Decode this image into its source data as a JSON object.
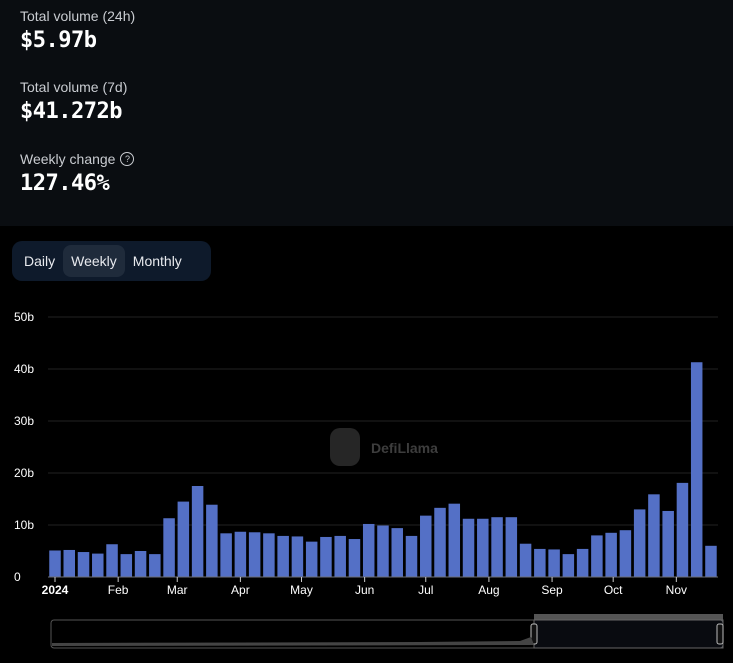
{
  "stats": [
    {
      "label": "Total volume (24h)",
      "value": "$5.97b"
    },
    {
      "label": "Total volume (7d)",
      "value": "$41.272b"
    },
    {
      "label": "Weekly change",
      "value": "127.46%",
      "icon": "help-circle-icon"
    }
  ],
  "toggle": {
    "options": [
      "Daily",
      "Weekly",
      "Monthly"
    ],
    "selected": "Weekly"
  },
  "watermark": "DefiLlama",
  "chart_data": {
    "type": "bar",
    "title": "",
    "xlabel": "",
    "ylabel": "",
    "bar_color": "#5470c6",
    "ylim": [
      0,
      50
    ],
    "yticks": [
      "0",
      "10b",
      "20b",
      "30b",
      "40b",
      "50b"
    ],
    "xtick_labels": [
      "2024",
      "Feb",
      "Mar",
      "Apr",
      "May",
      "Jun",
      "Jul",
      "Aug",
      "Sep",
      "Oct",
      "Nov"
    ],
    "xtick_dates": [
      "2024-01-01",
      "2024-02-01",
      "2024-03-01",
      "2024-04-01",
      "2024-05-01",
      "2024-06-01",
      "2024-07-01",
      "2024-08-01",
      "2024-09-01",
      "2024-10-01",
      "2024-11-01"
    ],
    "start_date": "2024-01-01",
    "interval": "weekly",
    "grid": true,
    "unit": "b",
    "values": [
      5.1,
      5.2,
      4.8,
      4.5,
      6.3,
      4.4,
      5.0,
      4.4,
      11.3,
      14.5,
      17.5,
      13.9,
      8.4,
      8.7,
      8.6,
      8.4,
      7.9,
      7.8,
      6.8,
      7.7,
      7.9,
      7.3,
      10.2,
      9.9,
      9.4,
      7.9,
      11.8,
      13.3,
      14.1,
      11.2,
      11.2,
      11.5,
      11.5,
      6.4,
      5.4,
      5.3,
      4.4,
      5.4,
      8.0,
      8.5,
      9.0,
      13.0,
      15.9,
      12.7,
      18.1,
      41.3,
      6.0
    ]
  }
}
